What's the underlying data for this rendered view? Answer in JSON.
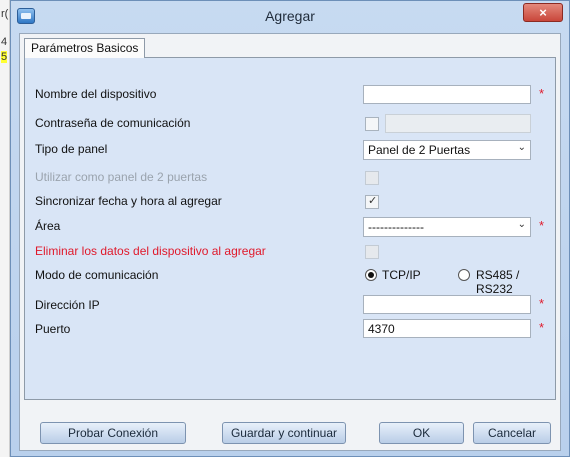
{
  "background": {
    "fragments": [
      "r(",
      "4",
      "5"
    ]
  },
  "window": {
    "title": "Agregar",
    "close_glyph": "×"
  },
  "tab": {
    "label": "Parámetros Basicos"
  },
  "form": {
    "device_name": {
      "label": "Nombre del dispositivo",
      "value": "",
      "required": "*"
    },
    "comm_password": {
      "label": "Contraseña de comunicación",
      "value": ""
    },
    "panel_type": {
      "label": "Tipo de panel",
      "selected": "Panel de 2 Puertas"
    },
    "use_as_2_door": {
      "label": "Utilizar como panel de 2 puertas"
    },
    "sync_time": {
      "label": "Sincronizar fecha y hora al agregar",
      "check_glyph": "✓"
    },
    "area": {
      "label": "Área",
      "selected": "--------------",
      "required": "*"
    },
    "delete_data": {
      "label": "Eliminar los datos del dispositivo al agregar"
    },
    "comm_mode": {
      "label": "Modo de comunicación",
      "options": [
        "TCP/IP",
        "RS485 / RS232"
      ],
      "selected": "TCP/IP"
    },
    "ip_address": {
      "label": "Dirección IP",
      "value": "",
      "required": "*"
    },
    "port": {
      "label": "Puerto",
      "value": "4370",
      "required": "*"
    }
  },
  "buttons": {
    "test_connection": "Probar Conexión",
    "save_continue": "Guardar y continuar",
    "ok": "OK",
    "cancel": "Cancelar"
  },
  "colors": {
    "required": "#e0192b",
    "close": "#c9463a",
    "panel": "#d9e5f6"
  }
}
